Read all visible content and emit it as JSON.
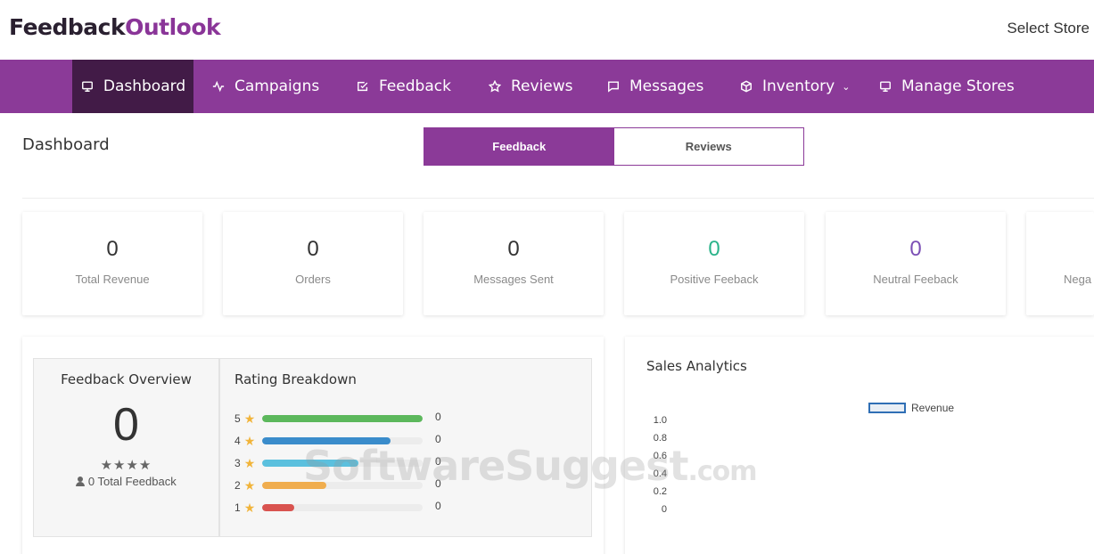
{
  "brand": {
    "logo_a": "Feedback",
    "logo_b": "Outlook"
  },
  "header": {
    "select_store": "Select Store"
  },
  "nav": [
    {
      "label": "Dashboard",
      "icon": "monitor-icon",
      "active": true
    },
    {
      "label": "Campaigns",
      "icon": "activity-icon"
    },
    {
      "label": "Feedback",
      "icon": "check-square-icon"
    },
    {
      "label": "Reviews",
      "icon": "star-icon"
    },
    {
      "label": "Messages",
      "icon": "message-icon"
    },
    {
      "label": "Inventory",
      "icon": "box-icon",
      "dropdown": true
    },
    {
      "label": "Manage Stores",
      "icon": "monitor-icon"
    }
  ],
  "page": {
    "title": "Dashboard"
  },
  "toggle": {
    "feedback": "Feedback",
    "reviews": "Reviews",
    "selected": "Feedback"
  },
  "stats": [
    {
      "value": "0",
      "label": "Total Revenue"
    },
    {
      "value": "0",
      "label": "Orders"
    },
    {
      "value": "0",
      "label": "Messages Sent"
    },
    {
      "value": "0",
      "label": "Positive Feeback",
      "color": "#2bb38a"
    },
    {
      "value": "0",
      "label": "Neutral Feeback",
      "color": "#7b4fb5"
    },
    {
      "value": "",
      "label": "Nega"
    }
  ],
  "feedback_overview": {
    "title": "Feedback Overview",
    "value": "0",
    "stars": "★★★★",
    "total": "0 Total Feedback"
  },
  "rating_breakdown": {
    "title": "Rating Breakdown",
    "rows": [
      {
        "rating": "5",
        "count": "0",
        "fill": 1.0,
        "color": "#5cb85c"
      },
      {
        "rating": "4",
        "count": "0",
        "fill": 0.8,
        "color": "#3a8ccb"
      },
      {
        "rating": "3",
        "count": "0",
        "fill": 0.6,
        "color": "#5bc0de"
      },
      {
        "rating": "2",
        "count": "0",
        "fill": 0.4,
        "color": "#f0ad4e"
      },
      {
        "rating": "1",
        "count": "0",
        "fill": 0.2,
        "color": "#d9534f"
      }
    ]
  },
  "sales_analytics": {
    "title": "Sales Analytics",
    "legend": "Revenue",
    "y_ticks": [
      "1.0",
      "0.8",
      "0.6",
      "0.4",
      "0.2",
      "0"
    ]
  },
  "watermark": {
    "main": "SoftwareSuggest",
    "suffix": ".com"
  }
}
